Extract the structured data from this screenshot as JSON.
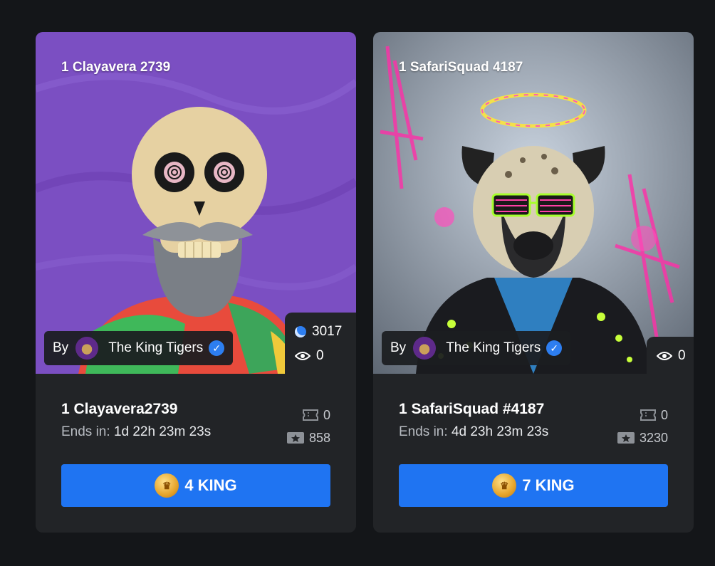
{
  "cards": [
    {
      "art_title": "1 Clayavera 2739",
      "creator_prefix": "By",
      "creator_name": "The King Tigers",
      "stat_count": "3017",
      "views": "0",
      "name": "1 Clayavera2739",
      "ends_label": "Ends in:",
      "ends_value": "1d 22h 23m 23s",
      "tickets": "0",
      "rating": "858",
      "price": "4 KING"
    },
    {
      "art_title": "1 SafariSquad 4187",
      "creator_prefix": "By",
      "creator_name": "The King Tigers",
      "views": "0",
      "name": "1 SafariSquad #4187",
      "ends_label": "Ends in:",
      "ends_value": "4d 23h 23m 23s",
      "tickets": "0",
      "rating": "3230",
      "price": "7 KING"
    }
  ],
  "colors": {
    "background": "#141619",
    "card": "#222427",
    "button": "#1f74f2",
    "verified": "#2d7ef0"
  }
}
